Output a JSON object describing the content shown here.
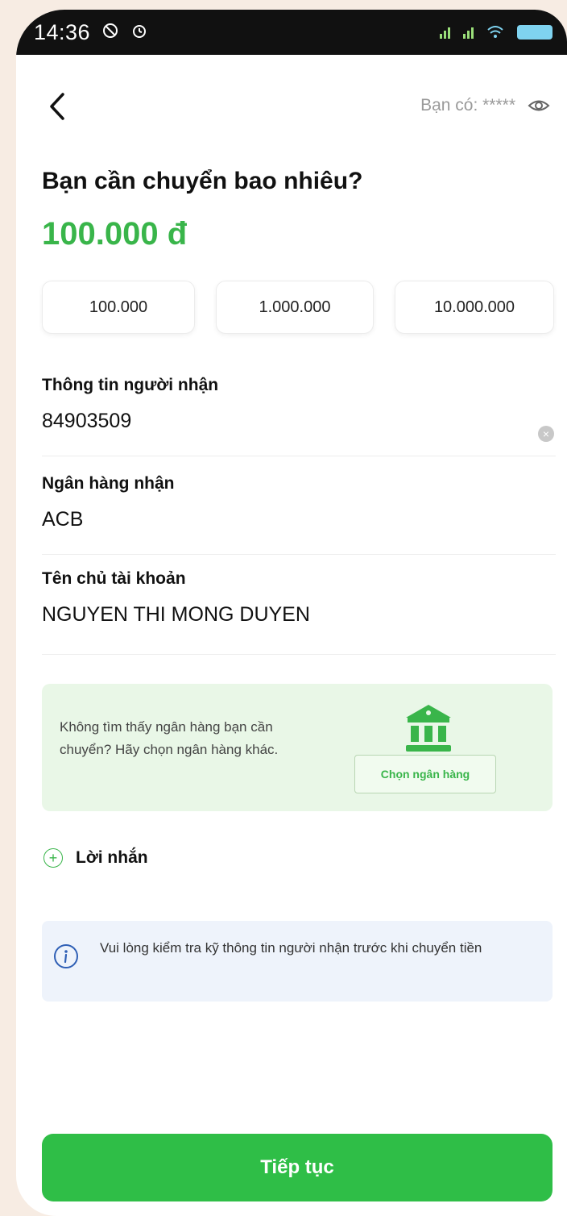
{
  "status_bar": {
    "time": "14:36",
    "icons": [
      "do-not-disturb-icon",
      "alarm-icon",
      "signal-icon",
      "signal-icon",
      "wifi-icon",
      "battery-icon"
    ]
  },
  "header": {
    "balance_label": "Bạn có: *****"
  },
  "transfer": {
    "question": "Bạn cần chuyển bao nhiêu?",
    "amount": "100.000 đ",
    "quick_amounts": [
      "100.000",
      "1.000.000",
      "10.000.000"
    ]
  },
  "recipient": {
    "info_label": "Thông tin người nhận",
    "info_value": "84903509",
    "bank_label": "Ngân hàng nhận",
    "bank_value": "ACB",
    "holder_label": "Tên chủ tài khoản",
    "holder_value": "NGUYEN THI MONG DUYEN"
  },
  "bank_notice": {
    "message": "Không tìm thấy ngân hàng bạn cần chuyển? Hãy chọn ngân hàng khác.",
    "button_label": "Chọn ngân hàng"
  },
  "note": {
    "label": "Lời nhắn"
  },
  "info_notice": {
    "message": "Vui lòng kiểm tra kỹ thông tin người nhận trước khi chuyển tiền"
  },
  "actions": {
    "continue_label": "Tiếp tục"
  },
  "colors": {
    "accent_green": "#39b54a",
    "button_green": "#2fbe47",
    "bank_box_bg": "#e9f7e7",
    "info_box_bg": "#eef3fb",
    "outer_bg": "#f7ece3"
  }
}
